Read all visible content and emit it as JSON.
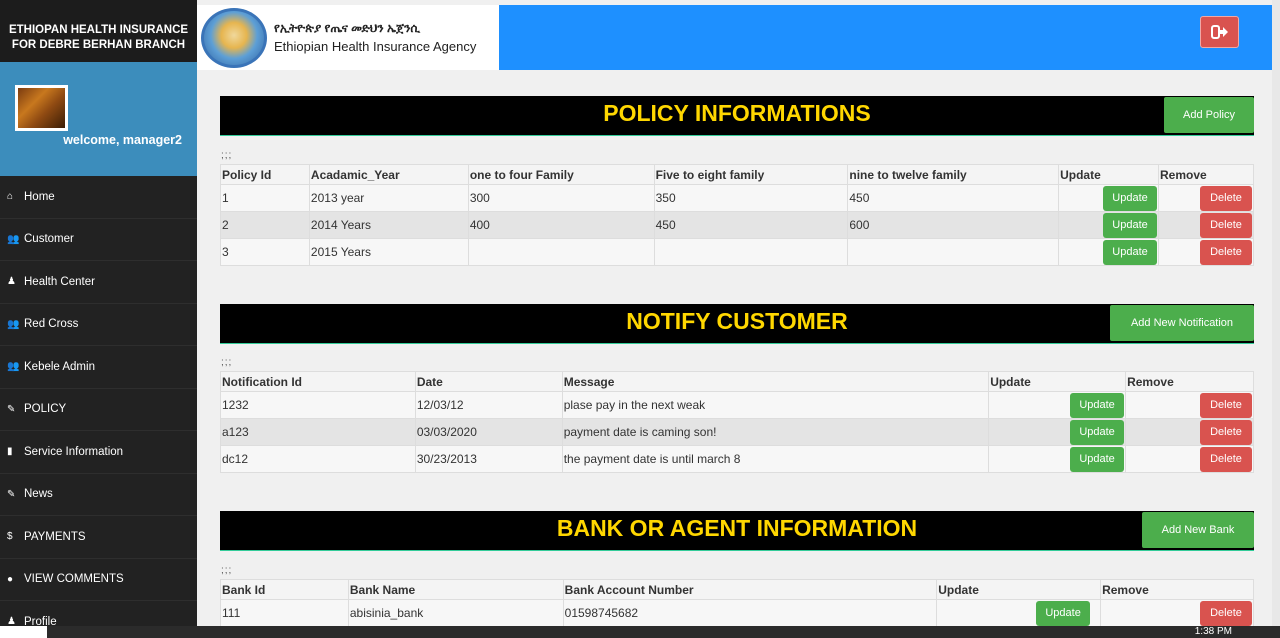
{
  "brand": {
    "line1": "ETHIOPAN HEALTH INSURANCE",
    "line2": "FOR DEBRE BERHAN BRANCH"
  },
  "profile": {
    "welcome": "welcome, manager2"
  },
  "nav": [
    {
      "icon": "home-icon",
      "glyph": "⌂",
      "label": "Home"
    },
    {
      "icon": "users-icon",
      "glyph": "👥",
      "label": "Customer"
    },
    {
      "icon": "user-icon",
      "glyph": "♟",
      "label": "Health Center"
    },
    {
      "icon": "users-icon",
      "glyph": "👥",
      "label": "Red Cross"
    },
    {
      "icon": "users-icon",
      "glyph": "👥",
      "label": "Kebele Admin"
    },
    {
      "icon": "edit-icon",
      "glyph": "✎",
      "label": "POLICY"
    },
    {
      "icon": "book-icon",
      "glyph": "▮",
      "label": "Service Information"
    },
    {
      "icon": "edit-icon",
      "glyph": "✎",
      "label": "News"
    },
    {
      "icon": "dollar-icon",
      "glyph": "$",
      "label": "PAYMENTS"
    },
    {
      "icon": "comment-icon",
      "glyph": "●",
      "label": "VIEW COMMENTS"
    },
    {
      "icon": "user-icon",
      "glyph": "♟",
      "label": "Profile"
    }
  ],
  "header": {
    "amharic": "የኢትዮጵያ የጤና መድህን ኤጀንሲ",
    "english": "Ethiopian Health Insurance Agency"
  },
  "policy": {
    "title": "POLICY INFORMATIONS",
    "add_label": "Add Policy",
    "semis": ";;;",
    "columns": [
      "Policy Id",
      "Acadamic_Year",
      "one to four Family",
      "Five to eight family",
      "nine to twelve family",
      "Update",
      "Remove"
    ],
    "rows": [
      [
        "1",
        "2013 year",
        "300",
        "350",
        "450"
      ],
      [
        "2",
        "2014 Years",
        "400",
        "450",
        "600"
      ],
      [
        "3",
        "2015 Years",
        "",
        "",
        ""
      ]
    ],
    "update_label": "Update",
    "delete_label": "Delete"
  },
  "notify": {
    "title": "NOTIFY CUSTOMER",
    "add_label": "Add New Notification",
    "semis": ";;;",
    "columns": [
      "Notification Id",
      "Date",
      "Message",
      "Update",
      "Remove"
    ],
    "rows": [
      [
        "1232",
        "12/03/12",
        "plase pay in the next weak"
      ],
      [
        "a123",
        "03/03/2020",
        "payment date is caming son!"
      ],
      [
        "dc12",
        "30/23/2013",
        "the payment date is until march 8"
      ]
    ],
    "update_label": "Update",
    "delete_label": "Delete"
  },
  "bank": {
    "title": "BANK OR AGENT INFORMATION",
    "add_label": "Add New Bank",
    "semis": ";;;",
    "columns": [
      "Bank Id",
      "Bank Name",
      "Bank Account Number",
      "Update",
      "Remove"
    ],
    "rows": [
      [
        "111",
        "abisinia_bank",
        "01598745682"
      ]
    ],
    "update_label": "Update",
    "delete_label": "Delete"
  },
  "taskbar": {
    "clock": "1:38 PM"
  },
  "colors": {
    "sidebar": "#222222",
    "profile": "#3c8dbc",
    "header": "#1e90ff",
    "title": "#ffd700",
    "update": "#4cae4c",
    "delete": "#d9534f"
  }
}
